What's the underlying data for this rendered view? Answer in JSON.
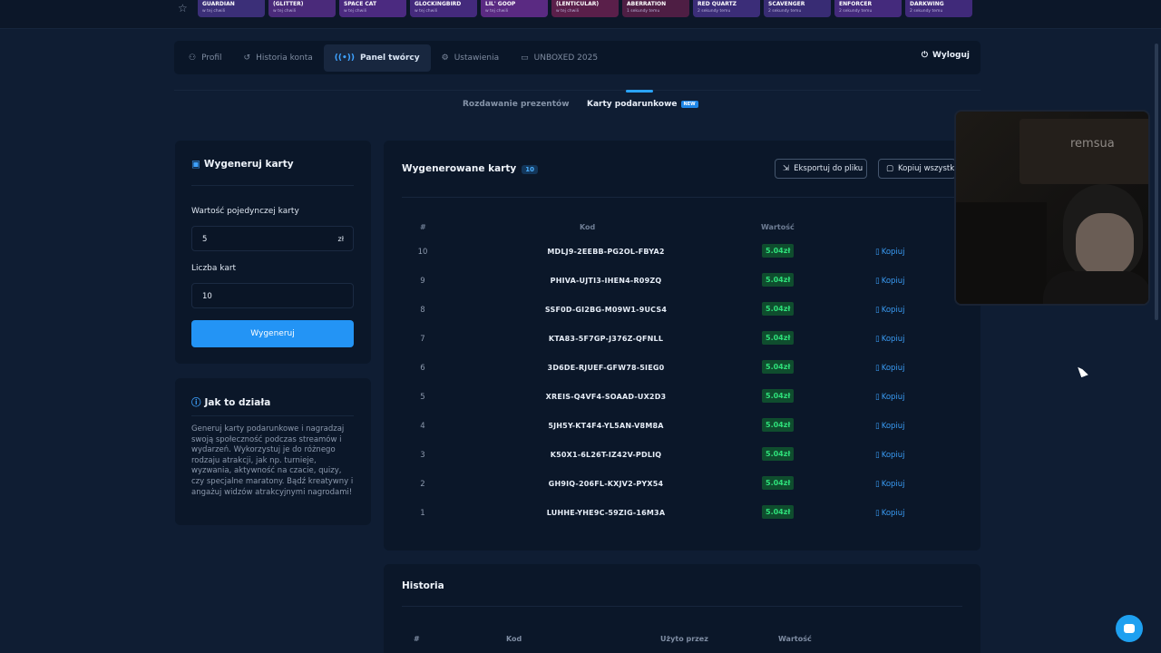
{
  "ticker": [
    {
      "name": "GUARDIAN",
      "time": "w tej chwili",
      "color": "#3b2f78"
    },
    {
      "name": "(GLITTER)",
      "time": "w tej chwili",
      "color": "#4a2a7a"
    },
    {
      "name": "SPACE CAT",
      "time": "w tej chwili",
      "color": "#4b2a80"
    },
    {
      "name": "GLOCKINGBIRD",
      "time": "w tej chwili",
      "color": "#442a7c"
    },
    {
      "name": "LIL' GOOP",
      "time": "w tej chwili",
      "color": "#5a2a82"
    },
    {
      "name": "(LENTICULAR)",
      "time": "w tej chwili",
      "color": "#5a1f4a"
    },
    {
      "name": "ABERRATION",
      "time": "1 sekundy temu",
      "color": "#4e1e44"
    },
    {
      "name": "RED QUARTZ",
      "time": "2 sekundy temu",
      "color": "#3b2d78"
    },
    {
      "name": "SCAVENGER",
      "time": "2 sekundy temu",
      "color": "#382c74"
    },
    {
      "name": "ENFORCER",
      "time": "2 sekundy temu",
      "color": "#442a7c"
    },
    {
      "name": "DARKWING",
      "time": "2 sekundy temu",
      "color": "#402a7a"
    }
  ],
  "nav": {
    "items": [
      {
        "label": "Profil",
        "icon": "user-icon"
      },
      {
        "label": "Historia konta",
        "icon": "history-icon"
      },
      {
        "label": "Panel twórcy",
        "icon": "broadcast-icon"
      },
      {
        "label": "Ustawienia",
        "icon": "gear-icon"
      },
      {
        "label": "UNBOXED 2025",
        "icon": "calendar-icon"
      }
    ],
    "logout": "Wyloguj"
  },
  "subtabs": {
    "gifts": "Rozdawanie prezentów",
    "cards": "Karty podarunkowe",
    "new_badge": "NEW"
  },
  "generate": {
    "title": "Wygeneruj karty",
    "value_label": "Wartość pojedynczej karty",
    "value": "5",
    "currency": "zł",
    "count_label": "Liczba kart",
    "count": "10",
    "button": "Wygeneruj"
  },
  "how": {
    "title": "Jak to działa",
    "text": "Generuj karty podarunkowe i nagradzaj swoją społeczność podczas streamów i wydarzeń. Wykorzystuj je do różnego rodzaju atrakcji, jak np. turnieje, wyzwania, aktywność na czacie, quizy, czy specjalne maratony. Bądź kreatywny i angażuj widzów atrakcyjnymi nagrodami!"
  },
  "cards": {
    "title": "Wygenerowane karty",
    "count": "10",
    "export": "Eksportuj do pliku",
    "copy_all": "Kopiuj wszystkie",
    "headers": {
      "idx": "#",
      "code": "Kod",
      "value": "Wartość"
    },
    "copy_label": "Kopiuj",
    "rows": [
      {
        "idx": "10",
        "code": "MDLJ9-2EEBB-PG2OL-FBYA2",
        "value": "5.04zł"
      },
      {
        "idx": "9",
        "code": "PHIVA-UJTI3-IHEN4-R09ZQ",
        "value": "5.04zł"
      },
      {
        "idx": "8",
        "code": "SSF0D-GI2BG-M09W1-9UCS4",
        "value": "5.04zł"
      },
      {
        "idx": "7",
        "code": "KTA83-5F7GP-J376Z-QFNLL",
        "value": "5.04zł"
      },
      {
        "idx": "6",
        "code": "3D6DE-RJUEF-GFW78-5IEG0",
        "value": "5.04zł"
      },
      {
        "idx": "5",
        "code": "XREIS-Q4VF4-SOAAD-UX2D3",
        "value": "5.04zł"
      },
      {
        "idx": "4",
        "code": "5JH5Y-KT4F4-YL5AN-V8M8A",
        "value": "5.04zł"
      },
      {
        "idx": "3",
        "code": "K50X1-6L26T-IZ42V-PDLIQ",
        "value": "5.04zł"
      },
      {
        "idx": "2",
        "code": "GH9IQ-206FL-KXJV2-PYX54",
        "value": "5.04zł"
      },
      {
        "idx": "1",
        "code": "LUHHE-YHE9C-59ZIG-16M3A",
        "value": "5.04zł"
      }
    ]
  },
  "history": {
    "title": "Historia",
    "headers": {
      "idx": "#",
      "code": "Kod",
      "used_by": "Użyto przez",
      "value": "Wartość"
    }
  },
  "webcam": {
    "sign": "remsua"
  },
  "colors": {
    "accent": "#2394f5",
    "value_green": "#2ee07a",
    "background": "#0f1d33"
  }
}
